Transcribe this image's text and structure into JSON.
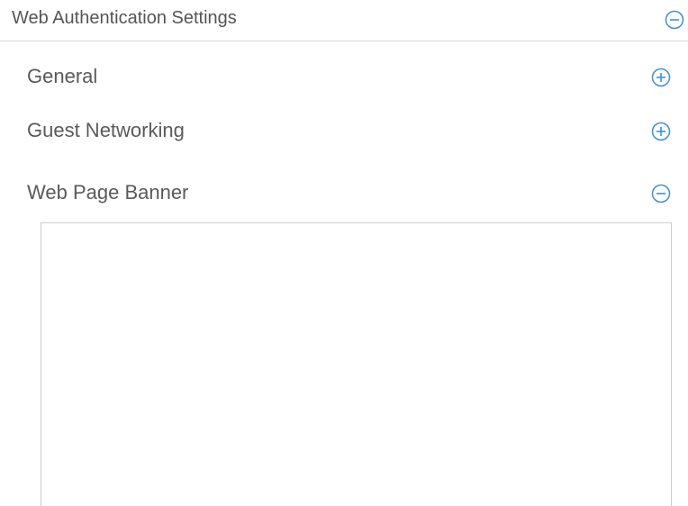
{
  "panel": {
    "title": "Web Authentication Settings",
    "expanded": true,
    "toggle_icon": "collapse-minus-icon",
    "accent_color": "#3d8fd6"
  },
  "subsections": [
    {
      "label": "General",
      "expanded": false,
      "toggle_icon": "expand-plus-icon"
    },
    {
      "label": "Guest Networking",
      "expanded": false,
      "toggle_icon": "expand-plus-icon"
    },
    {
      "label": "Web Page Banner",
      "expanded": true,
      "toggle_icon": "collapse-minus-icon"
    }
  ],
  "banner": {
    "value": ""
  }
}
